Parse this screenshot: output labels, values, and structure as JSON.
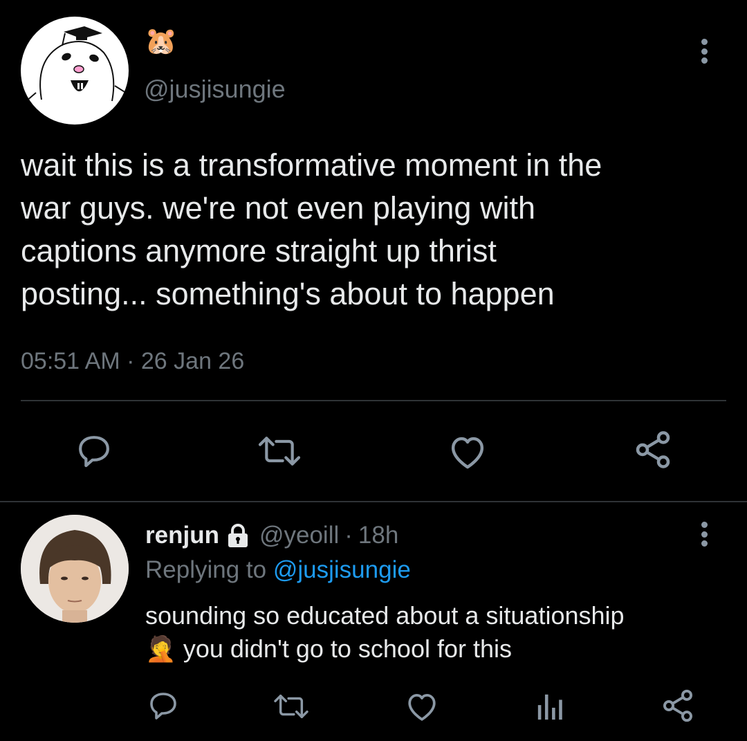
{
  "tweet": {
    "emoji": "🐹",
    "handle": "@jusjisungie",
    "text_lines": [
      "wait this is a transformative moment in the",
      "war guys. we're not even playing with",
      "captions anymore straight up thrist",
      "posting... something's about to happen"
    ],
    "time": "05:51 AM",
    "separator": "·",
    "date": "26 Jan 26",
    "icons": [
      "reply-icon",
      "retweet-icon",
      "like-icon",
      "share-icon"
    ]
  },
  "reply": {
    "name": "renjun",
    "handle": "@yeoill",
    "separator": "·",
    "age": "18h",
    "replying_prefix": "Replying to",
    "replying_handle": "@jusjisungie",
    "text_line1": "sounding so educated about a situationship",
    "text_emoji": "🤦",
    "text_line2": "you didn't go to school for this",
    "icons": [
      "reply-icon",
      "retweet-icon",
      "like-icon",
      "analytics-icon",
      "share-icon"
    ]
  },
  "colors": {
    "background": "#000000",
    "text": "#e7e9ea",
    "muted": "#6e767d",
    "link": "#1d9bf0",
    "divider": "#2f3336"
  }
}
